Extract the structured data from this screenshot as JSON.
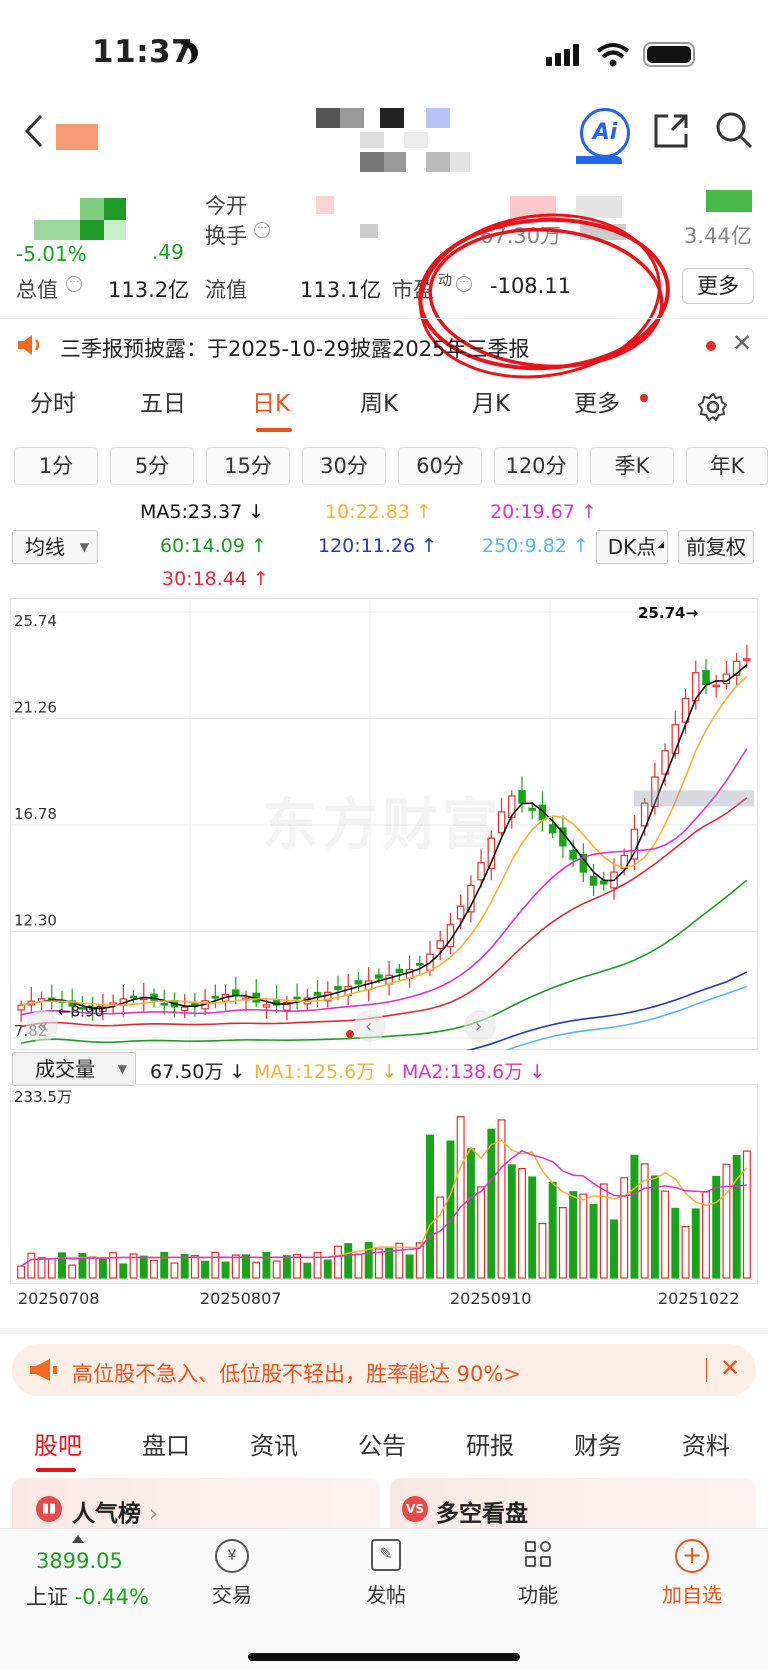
{
  "status": {
    "time": "11:37"
  },
  "quote": {
    "change_pct": "-5.01%",
    "open_label": "今开",
    "turnover_label": "换手",
    "total_value_label": "总值",
    "total_value": "113.2亿",
    "float_value_label": "流值",
    "float_value": "113.1亿",
    "pe_label": "市盈",
    "pe_suffix": "动",
    "pe_value": "-108.11",
    "more_label": "更多",
    "volume_partial": "67.30万",
    "amount_partial": "3.44亿",
    "price_partial": ".49"
  },
  "notice": {
    "text": "三季报预披露：于2025-10-29披露2025年三季报"
  },
  "tabs": [
    "分时",
    "五日",
    "日K",
    "周K",
    "月K",
    "更多"
  ],
  "periods": [
    "1分",
    "5分",
    "15分",
    "30分",
    "60分",
    "120分",
    "季K",
    "年K"
  ],
  "ma": {
    "selector": "均线",
    "ma5": "MA5:23.37",
    "ma10": "10:22.83",
    "ma20": "20:19.67",
    "ma60": "60:14.09",
    "ma120": "120:11.26",
    "ma250": "250:9.82",
    "ma30": "30:18.44",
    "dk": "DK点",
    "fq": "前复权"
  },
  "colors": {
    "ma5": "#111111",
    "ma10": "#f5b335",
    "ma20": "#d933c8",
    "ma30": "#d92b3a",
    "ma60": "#1f9a27",
    "ma120": "#2637b8",
    "ma250": "#5ab7ea",
    "up": "#e03030",
    "down": "#18a318"
  },
  "chart": {
    "y_ticks": [
      "25.74",
      "21.26",
      "16.78",
      "12.30",
      "7.82"
    ],
    "high_label": "25.74",
    "low_label": "8.90",
    "watermark": "东方财富"
  },
  "volume": {
    "selector": "成交量",
    "value": "67.50万",
    "ma1": "MA1:125.6万",
    "ma2": "MA2:138.6万",
    "max": "233.5万",
    "dates": [
      "20250708",
      "20250807",
      "20250910",
      "20251022"
    ]
  },
  "banner": {
    "text": "高位股不急入、低位股不轻出，胜率能达 90%>"
  },
  "bottom_tabs": [
    "股吧",
    "盘口",
    "资讯",
    "公告",
    "研报",
    "财务",
    "资料"
  ],
  "cards": {
    "hot": "人气榜",
    "vs": "多空看盘"
  },
  "index": {
    "value": "3899.05",
    "name": "上证",
    "change": "-0.44%"
  },
  "bottom_nav": [
    "交易",
    "发帖",
    "功能",
    "加自选"
  ]
}
